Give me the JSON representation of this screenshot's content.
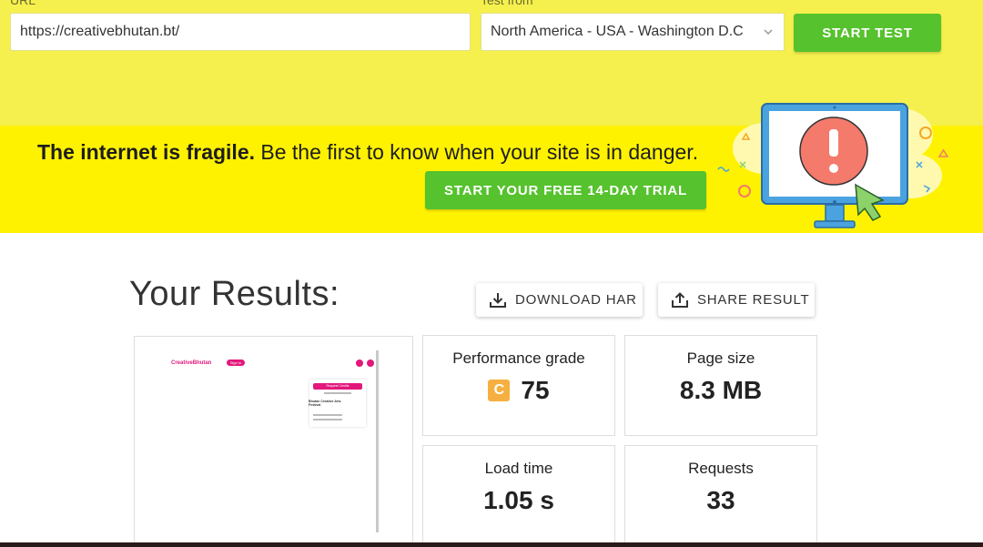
{
  "form": {
    "url_label": "URL",
    "url_value": "https://creativebhutan.bt/",
    "location_label": "Test from",
    "location_value": "North America - USA - Washington D.C",
    "start_test_label": "START TEST"
  },
  "banner": {
    "bold_text": "The internet is fragile.",
    "rest_text": " Be the first to know when your site is in danger.",
    "trial_label": "START YOUR FREE 14-DAY TRIAL"
  },
  "results": {
    "title": "Your Results:",
    "download_label": "DOWNLOAD HAR",
    "share_label": "SHARE RESULT",
    "preview": {
      "logo_a": "Creative",
      "logo_b": "Bhutan",
      "pill": "Sign in",
      "card_button": "Request Credits",
      "card_title": "Bhutan Creative Arts Festival"
    },
    "metrics": {
      "performance_label": "Performance grade",
      "performance_grade": "C",
      "performance_value": "75",
      "page_size_label": "Page size",
      "page_size_value": "8.3 MB",
      "load_time_label": "Load time",
      "load_time_value": "1.05 s",
      "requests_label": "Requests",
      "requests_value": "33"
    }
  },
  "colors": {
    "accent_green": "#56c22e",
    "banner_yellow": "#fff200",
    "testbar_yellow": "#f5f04d",
    "grade_orange": "#f5b041"
  }
}
